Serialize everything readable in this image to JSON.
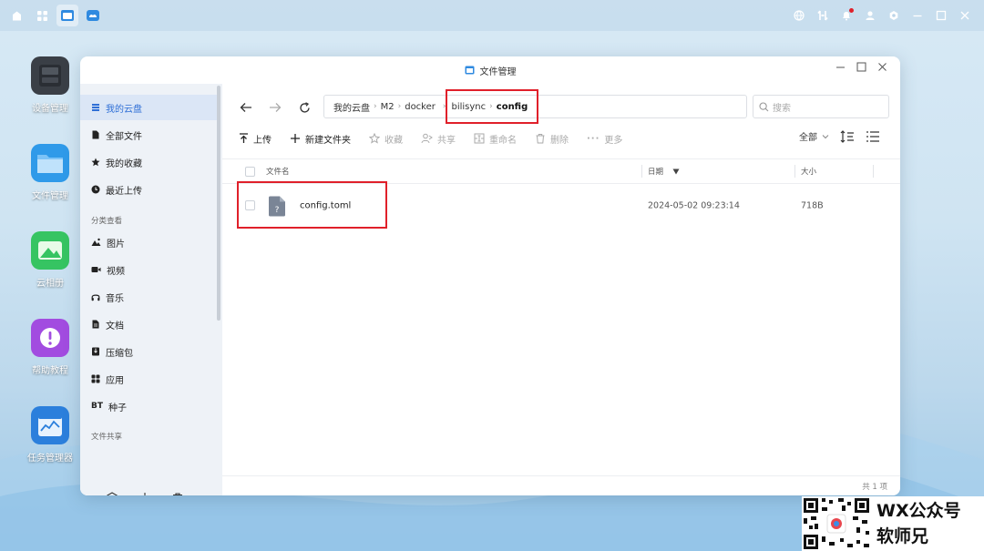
{
  "desktop": {
    "icons": [
      {
        "label": "设备管理"
      },
      {
        "label": "文件管理"
      },
      {
        "label": "云相册"
      },
      {
        "label": "帮助教程"
      },
      {
        "label": "任务管理器"
      }
    ]
  },
  "window": {
    "title": "文件管理"
  },
  "sidebar": {
    "items": [
      {
        "label": "我的云盘",
        "icon": "list-icon"
      },
      {
        "label": "全部文件",
        "icon": "file-icon"
      },
      {
        "label": "我的收藏",
        "icon": "star-icon"
      },
      {
        "label": "最近上传",
        "icon": "clock-icon"
      }
    ],
    "section_category": "分类查看",
    "categories": [
      {
        "label": "图片",
        "icon": "image-icon"
      },
      {
        "label": "视频",
        "icon": "video-icon"
      },
      {
        "label": "音乐",
        "icon": "headphone-icon"
      },
      {
        "label": "文档",
        "icon": "document-icon"
      },
      {
        "label": "压缩包",
        "icon": "archive-icon"
      },
      {
        "label": "应用",
        "icon": "apps-icon"
      },
      {
        "label": "种子",
        "prefix": "BT"
      }
    ],
    "section_share": "文件共享"
  },
  "breadcrumb": {
    "items": [
      "我的云盘",
      "M2",
      "docker",
      "bilisync",
      "config"
    ]
  },
  "search": {
    "placeholder": "搜索"
  },
  "toolbar": {
    "upload": "上传",
    "new_folder": "新建文件夹",
    "favorite": "收藏",
    "share": "共享",
    "rename": "重命名",
    "delete": "删除",
    "more": "更多",
    "filter": "全部"
  },
  "table": {
    "headers": {
      "name": "文件名",
      "date": "日期",
      "size": "大小"
    },
    "rows": [
      {
        "name": "config.toml",
        "date": "2024-05-02 09:23:14",
        "size": "718B"
      }
    ]
  },
  "status": {
    "count": "共 1 项"
  },
  "watermark": {
    "line1": "WX公众号",
    "line2": "软师兄"
  },
  "colors": {
    "accent": "#2f6fd6",
    "highlight": "#e0202a"
  }
}
